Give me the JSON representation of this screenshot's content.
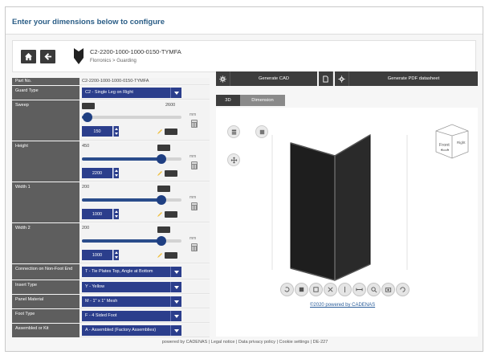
{
  "header": {
    "title": "Enter your dimensions below to configure"
  },
  "product": {
    "part_number": "C2-2200-1000-1000-0150-TYMFA",
    "breadcrumb": {
      "parent": "Florronics",
      "separator": ">",
      "current": "Guarding"
    }
  },
  "params": {
    "part_no": {
      "label": "Part No.",
      "value": "C2-2200-1000-1000-0150-TYMFA"
    },
    "guard_type": {
      "label": "Guard Type",
      "value": "C2 - Single Leg on Right"
    },
    "sweep": {
      "label": "Sweep",
      "max": "2600",
      "value": "150",
      "unit": "mm",
      "level": 0.06
    },
    "height": {
      "label": "Height",
      "min": "450",
      "value": "2200",
      "unit": "mm",
      "level": 0.8
    },
    "width1": {
      "label": "Width 1",
      "min": "200",
      "value": "1000",
      "unit": "mm",
      "level": 0.8
    },
    "width2": {
      "label": "Width 2",
      "min": "200",
      "value": "1000",
      "unit": "mm",
      "level": 0.8
    },
    "connection": {
      "label": "Connection on Non-Foot End",
      "value": "T - Tie Plates Top, Angle at Bottom"
    },
    "insert_type": {
      "label": "Insert Type",
      "value": "Y - Yellow"
    },
    "panel_material": {
      "label": "Panel Material",
      "value": "M - 1\" x 1\" Mesh"
    },
    "foot_type": {
      "label": "Foot Type",
      "value": "F - 4 Sided Foot"
    },
    "assembled": {
      "label": "Assembled or Kit",
      "value": "A - Assembled (Factory Assemblies)"
    }
  },
  "viewer": {
    "generate_cad": "Generate CAD",
    "generate_pdf": "Generate PDF datasheet",
    "tabs": [
      "3D",
      "Dimension"
    ],
    "active_tab": "Dimension",
    "cube_labels": {
      "front": "Front",
      "right": "Right"
    },
    "link": "©2020 powered by CADENAS"
  },
  "footer": {
    "text": "powered by CADENAS | Legal notice | Data privacy policy | Cookie settings | DE-227"
  },
  "colors": {
    "accent": "#2b3e8c",
    "dark": "#3d3d3d",
    "label_bg": "#5e5e5e",
    "title": "#2a5d86"
  }
}
